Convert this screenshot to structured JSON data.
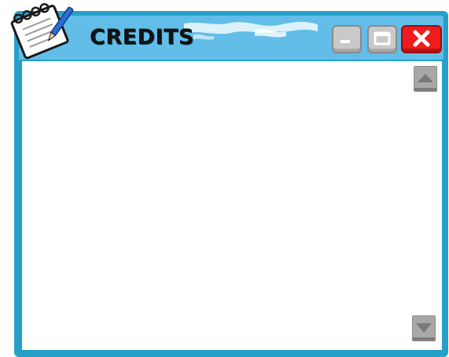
{
  "window": {
    "title": "CREDITS",
    "icon": "notebook-icon",
    "controls": {
      "minimize": "minimize-icon",
      "maximize": "maximize-icon",
      "close": "close-icon"
    }
  },
  "content": {
    "scroll_up": "arrow-up-icon",
    "scroll_down": "arrow-down-icon"
  },
  "colors": {
    "frame": "#27a0c8",
    "titlebar": "#62bde9",
    "close_button": "#ee1c1c",
    "scroll_button": "#a8a8a8"
  }
}
